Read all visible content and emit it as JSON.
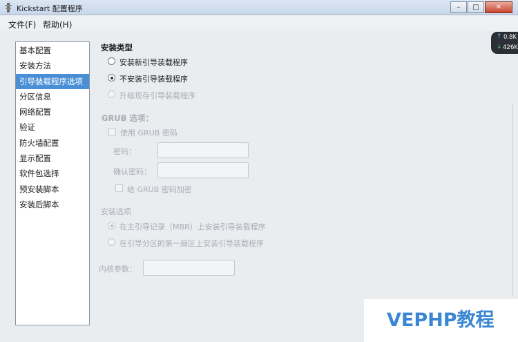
{
  "window": {
    "title": "Kickstart 配置程序"
  },
  "menu": [
    {
      "label": "文件(F)"
    },
    {
      "label": "帮助(H)"
    }
  ],
  "sidebar": {
    "items": [
      {
        "label": "基本配置"
      },
      {
        "label": "安装方法"
      },
      {
        "label": "引导装载程序选项",
        "selected": true
      },
      {
        "label": "分区信息"
      },
      {
        "label": "网络配置"
      },
      {
        "label": "验证"
      },
      {
        "label": "防火墙配置"
      },
      {
        "label": "显示配置"
      },
      {
        "label": "软件包选择"
      },
      {
        "label": "预安装脚本"
      },
      {
        "label": "安装后脚本"
      }
    ]
  },
  "install_type": {
    "heading": "安装类型",
    "options": [
      {
        "label": "安装新引导装载程序",
        "selected": false,
        "enabled": true
      },
      {
        "label": "不安装引导装载程序",
        "selected": true,
        "enabled": true
      },
      {
        "label": "升级现存引导装载程序",
        "selected": false,
        "enabled": false
      }
    ]
  },
  "grub": {
    "heading": "GRUB 选项：",
    "use_password_label": "使用  GRUB 密码",
    "password_label": "密码：",
    "confirm_label": "确认密码：",
    "password_value": "",
    "confirm_value": "",
    "encrypt_label": "给  GRUB 密码加密"
  },
  "install_options": {
    "heading": "安装选项",
    "options": [
      {
        "label": "在主引导记录（MBR）上安装引导装载程序",
        "selected": true,
        "enabled": false
      },
      {
        "label": "在引导分区的第一扇区上安装引导装载程序",
        "selected": false,
        "enabled": false
      }
    ]
  },
  "kernel": {
    "label": "内核参数：",
    "value": ""
  },
  "net_widget": {
    "up": "0.8K",
    "down": "426K"
  },
  "watermark": {
    "text": "VEPHP教程"
  }
}
